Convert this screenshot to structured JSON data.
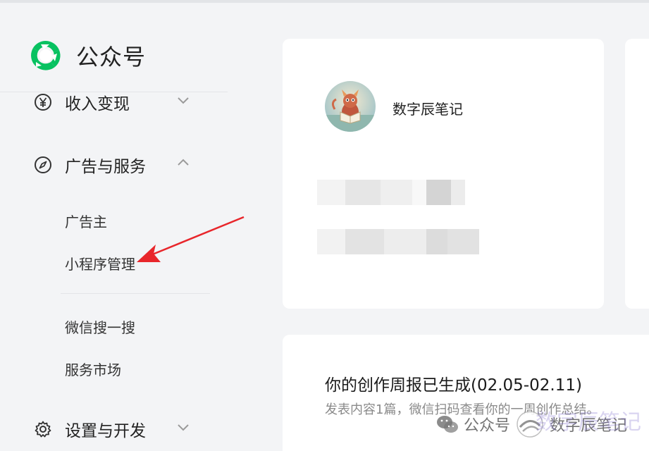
{
  "brand": {
    "name": "公众号",
    "logo_icon": "wechat-official-account-logo"
  },
  "sidebar": {
    "groups": [
      {
        "label": "收入变现",
        "icon": "yen-coin-icon",
        "expanded": false
      },
      {
        "label": "广告与服务",
        "icon": "compass-icon",
        "expanded": true
      },
      {
        "label": "设置与开发",
        "icon": "gear-icon",
        "expanded": false
      }
    ],
    "sub_items": [
      {
        "label": "广告主"
      },
      {
        "label": "小程序管理"
      },
      {
        "label": "微信搜一搜"
      },
      {
        "label": "服务市场"
      }
    ]
  },
  "profile": {
    "account_name": "数字辰笔记"
  },
  "report": {
    "title": "你的创作周报已生成(02.05-02.11)",
    "description": "发表内容1篇，微信扫码查看你的一周创作总结。"
  },
  "watermark": {
    "text1": "公众号",
    "text2": "数字辰笔记",
    "overlay_text": "数字辰笔记 数"
  },
  "colors": {
    "accent_green": "#07c160",
    "annotation_red": "#e8262b",
    "background": "#f3f4f6"
  }
}
